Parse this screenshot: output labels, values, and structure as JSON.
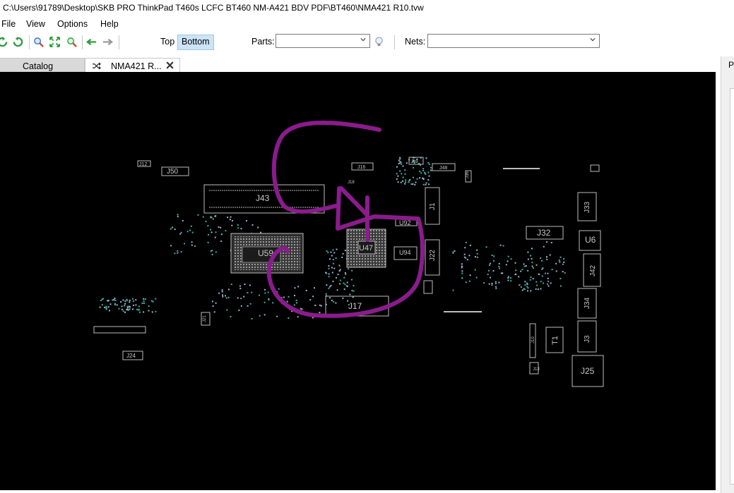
{
  "window": {
    "title": "C:\\Users\\91789\\Desktop\\SKB PRO ThinkPad T460s LCFC BT460 NM-A421 BDV PDF\\BT460\\NMA421 R10.tvw"
  },
  "menu": [
    "File",
    "View",
    "Options",
    "Help"
  ],
  "toolbar": {
    "side_top": "Top",
    "side_bottom": "Bottom",
    "active_side": "Bottom",
    "parts_label": "Parts:",
    "parts_value": "",
    "nets_label": "Nets:",
    "nets_value": ""
  },
  "tabs": [
    {
      "label": "Catalog",
      "active": false
    },
    {
      "label": "NMA421 R...",
      "active": true
    }
  ],
  "right_panel": {
    "label": "P"
  },
  "board": {
    "background": "#000000",
    "silkscreen_color": "#c8c8c8",
    "annotation_color": "#8a1c8c",
    "component_labels": [
      "J12",
      "J50",
      "J43",
      "U59",
      "J16",
      "J49",
      "J48",
      "J1",
      "J18",
      "U92",
      "U47",
      "U94",
      "J22",
      "J17",
      "J32",
      "J33",
      "U6",
      "J42",
      "J34",
      "J3",
      "J25",
      "T1",
      "J24",
      "J21",
      "J10",
      "J13",
      "J36"
    ]
  }
}
